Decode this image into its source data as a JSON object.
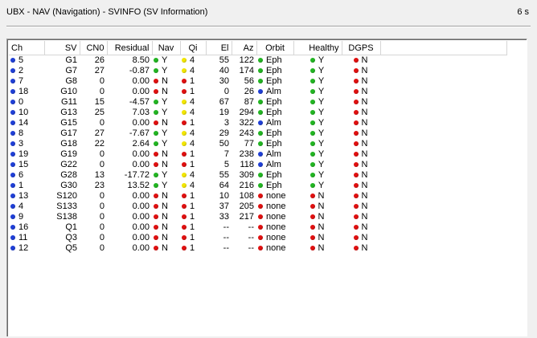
{
  "window": {
    "title": "UBX - NAV (Navigation) - SVINFO (SV Information)",
    "age": "6 s"
  },
  "colors": {
    "green": "#22b522",
    "yellow": "#f2e600",
    "red": "#e01010",
    "blue": "#1f3fd6"
  },
  "columns": [
    "Ch",
    "SV",
    "CN0",
    "Residual",
    "Nav",
    "Qi",
    "El",
    "Az",
    "Orbit",
    "Healthy",
    "DGPS"
  ],
  "rows": [
    {
      "ch": "5",
      "sv": "G1",
      "cn0": "26",
      "res": "8.50",
      "navc": "green",
      "nav": "Y",
      "qic": "yellow",
      "qi": "4",
      "el": "55",
      "az": "122",
      "orbc": "green",
      "orb": "Eph",
      "hc": "green",
      "h": "Y",
      "dc": "red",
      "d": "N"
    },
    {
      "ch": "2",
      "sv": "G7",
      "cn0": "27",
      "res": "-0.87",
      "navc": "green",
      "nav": "Y",
      "qic": "yellow",
      "qi": "4",
      "el": "40",
      "az": "174",
      "orbc": "green",
      "orb": "Eph",
      "hc": "green",
      "h": "Y",
      "dc": "red",
      "d": "N"
    },
    {
      "ch": "7",
      "sv": "G8",
      "cn0": "0",
      "res": "0.00",
      "navc": "red",
      "nav": "N",
      "qic": "red",
      "qi": "1",
      "el": "30",
      "az": "56",
      "orbc": "green",
      "orb": "Eph",
      "hc": "green",
      "h": "Y",
      "dc": "red",
      "d": "N"
    },
    {
      "ch": "18",
      "sv": "G10",
      "cn0": "0",
      "res": "0.00",
      "navc": "red",
      "nav": "N",
      "qic": "red",
      "qi": "1",
      "el": "0",
      "az": "26",
      "orbc": "blue",
      "orb": "Alm",
      "hc": "green",
      "h": "Y",
      "dc": "red",
      "d": "N"
    },
    {
      "ch": "0",
      "sv": "G11",
      "cn0": "15",
      "res": "-4.57",
      "navc": "green",
      "nav": "Y",
      "qic": "yellow",
      "qi": "4",
      "el": "67",
      "az": "87",
      "orbc": "green",
      "orb": "Eph",
      "hc": "green",
      "h": "Y",
      "dc": "red",
      "d": "N"
    },
    {
      "ch": "10",
      "sv": "G13",
      "cn0": "25",
      "res": "7.03",
      "navc": "green",
      "nav": "Y",
      "qic": "yellow",
      "qi": "4",
      "el": "19",
      "az": "294",
      "orbc": "green",
      "orb": "Eph",
      "hc": "green",
      "h": "Y",
      "dc": "red",
      "d": "N"
    },
    {
      "ch": "14",
      "sv": "G15",
      "cn0": "0",
      "res": "0.00",
      "navc": "red",
      "nav": "N",
      "qic": "red",
      "qi": "1",
      "el": "3",
      "az": "322",
      "orbc": "blue",
      "orb": "Alm",
      "hc": "green",
      "h": "Y",
      "dc": "red",
      "d": "N"
    },
    {
      "ch": "8",
      "sv": "G17",
      "cn0": "27",
      "res": "-7.67",
      "navc": "green",
      "nav": "Y",
      "qic": "yellow",
      "qi": "4",
      "el": "29",
      "az": "243",
      "orbc": "green",
      "orb": "Eph",
      "hc": "green",
      "h": "Y",
      "dc": "red",
      "d": "N"
    },
    {
      "ch": "3",
      "sv": "G18",
      "cn0": "22",
      "res": "2.64",
      "navc": "green",
      "nav": "Y",
      "qic": "yellow",
      "qi": "4",
      "el": "50",
      "az": "77",
      "orbc": "green",
      "orb": "Eph",
      "hc": "green",
      "h": "Y",
      "dc": "red",
      "d": "N"
    },
    {
      "ch": "19",
      "sv": "G19",
      "cn0": "0",
      "res": "0.00",
      "navc": "red",
      "nav": "N",
      "qic": "red",
      "qi": "1",
      "el": "7",
      "az": "238",
      "orbc": "blue",
      "orb": "Alm",
      "hc": "green",
      "h": "Y",
      "dc": "red",
      "d": "N"
    },
    {
      "ch": "15",
      "sv": "G22",
      "cn0": "0",
      "res": "0.00",
      "navc": "red",
      "nav": "N",
      "qic": "red",
      "qi": "1",
      "el": "5",
      "az": "118",
      "orbc": "blue",
      "orb": "Alm",
      "hc": "green",
      "h": "Y",
      "dc": "red",
      "d": "N"
    },
    {
      "ch": "6",
      "sv": "G28",
      "cn0": "13",
      "res": "-17.72",
      "navc": "green",
      "nav": "Y",
      "qic": "yellow",
      "qi": "4",
      "el": "55",
      "az": "309",
      "orbc": "green",
      "orb": "Eph",
      "hc": "green",
      "h": "Y",
      "dc": "red",
      "d": "N"
    },
    {
      "ch": "1",
      "sv": "G30",
      "cn0": "23",
      "res": "13.52",
      "navc": "green",
      "nav": "Y",
      "qic": "yellow",
      "qi": "4",
      "el": "64",
      "az": "216",
      "orbc": "green",
      "orb": "Eph",
      "hc": "green",
      "h": "Y",
      "dc": "red",
      "d": "N"
    },
    {
      "ch": "13",
      "sv": "S120",
      "cn0": "0",
      "res": "0.00",
      "navc": "red",
      "nav": "N",
      "qic": "red",
      "qi": "1",
      "el": "10",
      "az": "108",
      "orbc": "red",
      "orb": "none",
      "hc": "red",
      "h": "N",
      "dc": "red",
      "d": "N"
    },
    {
      "ch": "4",
      "sv": "S133",
      "cn0": "0",
      "res": "0.00",
      "navc": "red",
      "nav": "N",
      "qic": "red",
      "qi": "1",
      "el": "37",
      "az": "205",
      "orbc": "red",
      "orb": "none",
      "hc": "red",
      "h": "N",
      "dc": "red",
      "d": "N"
    },
    {
      "ch": "9",
      "sv": "S138",
      "cn0": "0",
      "res": "0.00",
      "navc": "red",
      "nav": "N",
      "qic": "red",
      "qi": "1",
      "el": "33",
      "az": "217",
      "orbc": "red",
      "orb": "none",
      "hc": "red",
      "h": "N",
      "dc": "red",
      "d": "N"
    },
    {
      "ch": "16",
      "sv": "Q1",
      "cn0": "0",
      "res": "0.00",
      "navc": "red",
      "nav": "N",
      "qic": "red",
      "qi": "1",
      "el": "--",
      "az": "--",
      "orbc": "red",
      "orb": "none",
      "hc": "red",
      "h": "N",
      "dc": "red",
      "d": "N"
    },
    {
      "ch": "11",
      "sv": "Q3",
      "cn0": "0",
      "res": "0.00",
      "navc": "red",
      "nav": "N",
      "qic": "red",
      "qi": "1",
      "el": "--",
      "az": "--",
      "orbc": "red",
      "orb": "none",
      "hc": "red",
      "h": "N",
      "dc": "red",
      "d": "N"
    },
    {
      "ch": "12",
      "sv": "Q5",
      "cn0": "0",
      "res": "0.00",
      "navc": "red",
      "nav": "N",
      "qic": "red",
      "qi": "1",
      "el": "--",
      "az": "--",
      "orbc": "red",
      "orb": "none",
      "hc": "red",
      "h": "N",
      "dc": "red",
      "d": "N"
    }
  ]
}
